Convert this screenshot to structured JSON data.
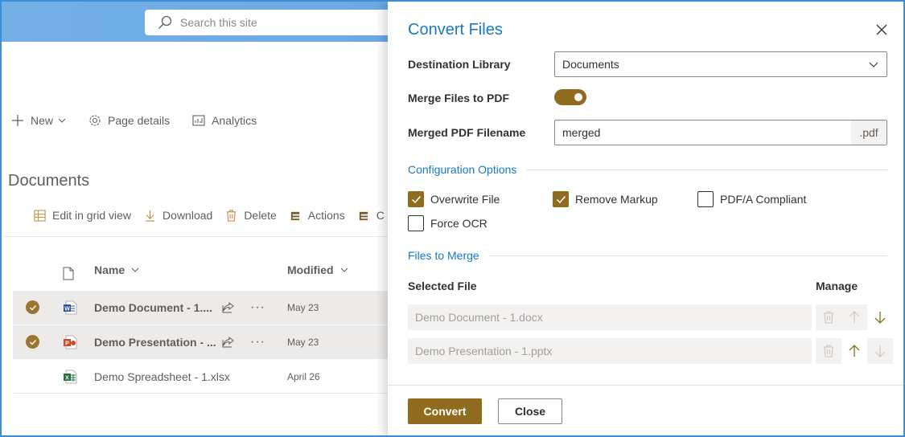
{
  "site": {
    "search_placeholder": "Search this site"
  },
  "page_commands": [
    {
      "label": "New",
      "icon": "plus-icon"
    },
    {
      "label": "Page details",
      "icon": "gear-icon"
    },
    {
      "label": "Analytics",
      "icon": "analytics-icon"
    }
  ],
  "library": {
    "title": "Documents",
    "commands": [
      {
        "label": "Edit in grid view",
        "icon": "grid-icon"
      },
      {
        "label": "Download",
        "icon": "download-icon"
      },
      {
        "label": "Delete",
        "icon": "trash-icon"
      },
      {
        "label": "Actions",
        "icon": "actions-icon"
      },
      {
        "label": "C",
        "icon": "actions-icon"
      }
    ],
    "columns": {
      "name": "Name",
      "modified": "Modified"
    },
    "files": [
      {
        "name": "Demo Document - 1....",
        "type": "word",
        "modified": "May 23",
        "selected": true
      },
      {
        "name": "Demo Presentation - ...",
        "type": "powerpoint",
        "modified": "May 23",
        "selected": true
      },
      {
        "name": "Demo Spreadsheet - 1.xlsx",
        "type": "excel",
        "modified": "April 26",
        "selected": false
      }
    ]
  },
  "panel": {
    "title": "Convert Files",
    "destination_label": "Destination Library",
    "destination_value": "Documents",
    "merge_label": "Merge Files to PDF",
    "merge_enabled": true,
    "filename_label": "Merged PDF Filename",
    "filename_value": "merged",
    "filename_suffix": ".pdf",
    "config_heading": "Configuration Options",
    "options": [
      {
        "label": "Overwrite File",
        "checked": true
      },
      {
        "label": "Remove Markup",
        "checked": true
      },
      {
        "label": "PDF/A Compliant",
        "checked": false
      },
      {
        "label": "Force OCR",
        "checked": false
      }
    ],
    "merge_heading": "Files to Merge",
    "selected_file_col": "Selected File",
    "manage_col": "Manage",
    "merge_files": [
      "Demo Document - 1.docx",
      "Demo Presentation - 1.pptx"
    ],
    "convert_label": "Convert",
    "close_label": "Close"
  },
  "colors": {
    "accent": "#8f6c1f",
    "link_blue": "#1979c3",
    "header_blue": "#5c9fdd"
  }
}
